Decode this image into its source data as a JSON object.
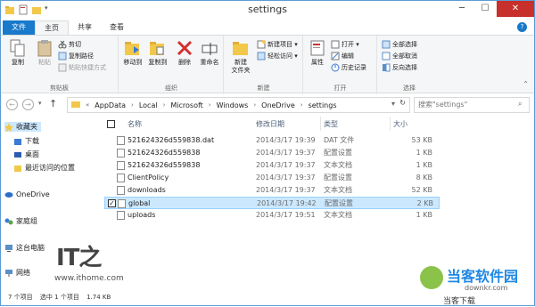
{
  "window": {
    "title": "settings"
  },
  "tabs": [
    "文件",
    "主页",
    "共享",
    "查看"
  ],
  "ribbon": {
    "clipboard": {
      "label": "剪贴板",
      "copy": "复制",
      "paste": "粘贴",
      "cut": "剪切",
      "copy_path": "复制路径",
      "paste_shortcut": "粘贴快捷方式"
    },
    "organize": {
      "label": "组织",
      "move_to": "移动到",
      "copy_to": "复制到",
      "delete": "删除",
      "rename": "重命名"
    },
    "new": {
      "label": "新建",
      "new_folder": "新建\n文件夹",
      "new_item": "新建项目 ▾",
      "easy_access": "轻松访问 ▾"
    },
    "open": {
      "label": "打开",
      "properties": "属性",
      "open": "打开 ▾",
      "edit": "编辑",
      "history": "历史记录"
    },
    "select": {
      "label": "选择",
      "select_all": "全部选择",
      "select_none": "全部取消",
      "invert": "反向选择"
    }
  },
  "address": {
    "path": [
      "AppData",
      "Local",
      "Microsoft",
      "Windows",
      "OneDrive",
      "settings"
    ],
    "search_placeholder": "搜索\"settings\""
  },
  "nav": {
    "favorites": "收藏夹",
    "downloads": "下载",
    "desktop": "桌面",
    "recent": "最近访问的位置",
    "onedrive": "OneDrive",
    "homegroup": "家庭组",
    "thispc": "这台电脑",
    "network": "网络"
  },
  "columns": {
    "name": "名称",
    "date": "修改日期",
    "type": "类型",
    "size": "大小"
  },
  "files": [
    {
      "name": "521624326d559838.dat",
      "date": "2014/3/17 19:39",
      "type": "DAT 文件",
      "size": "53 KB"
    },
    {
      "name": "521624326d559838",
      "date": "2014/3/17 19:37",
      "type": "配置设置",
      "size": "1 KB"
    },
    {
      "name": "521624326d559838",
      "date": "2014/3/17 19:37",
      "type": "文本文档",
      "size": "1 KB"
    },
    {
      "name": "ClientPolicy",
      "date": "2014/3/17 19:37",
      "type": "配置设置",
      "size": "8 KB"
    },
    {
      "name": "downloads",
      "date": "2014/3/17 19:37",
      "type": "文本文档",
      "size": "52 KB"
    },
    {
      "name": "global",
      "date": "2014/3/17 19:42",
      "type": "配置设置",
      "size": "2 KB"
    },
    {
      "name": "uploads",
      "date": "2014/3/17 19:51",
      "type": "文本文档",
      "size": "1 KB"
    }
  ],
  "status": {
    "count": "7 个项目",
    "selected": "选中 1 个项目",
    "size": "1.74 KB"
  },
  "watermarks": {
    "ithome_url": "www.ithome.com",
    "site_name": "当客软件园",
    "site_url": "downkr.com",
    "site_tag": "当客下载"
  }
}
